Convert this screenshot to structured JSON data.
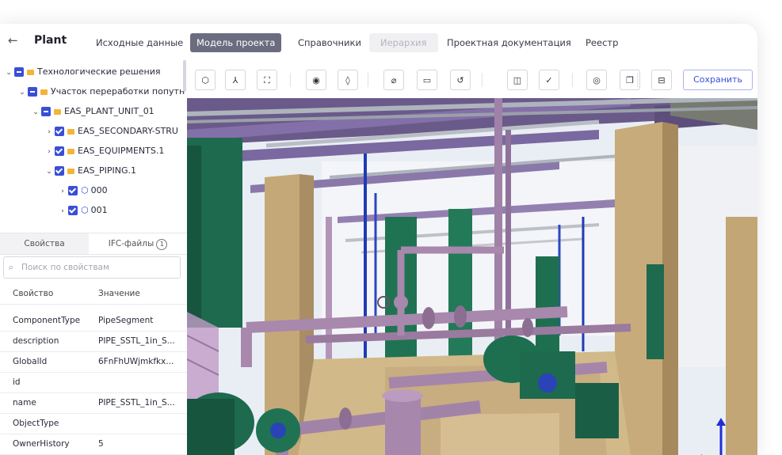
{
  "header": {
    "back_icon": "arrow-left-icon",
    "title": "Plant",
    "tabs": [
      {
        "label": "Исходные данные",
        "state": "normal"
      },
      {
        "label": "Модель проекта",
        "state": "active"
      },
      {
        "label": "Справочники",
        "state": "normal"
      },
      {
        "label": "Иерархия",
        "state": "disabled"
      },
      {
        "label": "Проектная документация",
        "state": "normal"
      },
      {
        "label": "Реестр",
        "state": "normal"
      }
    ]
  },
  "tree": {
    "items": [
      {
        "label": "Технологические решения",
        "level": 0,
        "check": "partial",
        "kind": "folder"
      },
      {
        "label": "Участок переработки попутн",
        "level": 1,
        "check": "partial",
        "kind": "folder"
      },
      {
        "label": "EAS_PLANT_UNIT_01",
        "level": 2,
        "check": "partial",
        "kind": "folder"
      },
      {
        "label": "EAS_SECONDARY-STRU",
        "level": 3,
        "check": "checked",
        "kind": "folder"
      },
      {
        "label": "EAS_EQUIPMENTS.1",
        "level": 3,
        "check": "checked",
        "kind": "folder"
      },
      {
        "label": "EAS_PIPING.1",
        "level": 3,
        "check": "checked",
        "kind": "folder"
      },
      {
        "label": "000",
        "level": 4,
        "check": "checked",
        "kind": "object"
      },
      {
        "label": "001",
        "level": 4,
        "check": "checked",
        "kind": "object"
      }
    ]
  },
  "panel": {
    "tabs": [
      {
        "label": "Свойства",
        "active": true
      },
      {
        "label": "IFC-файлы",
        "count": "1",
        "active": false
      }
    ],
    "search_placeholder": "Поиск по свойствам",
    "columns": {
      "key": "Свойство",
      "value": "Значение"
    },
    "rows": [
      {
        "key": "ComponentType",
        "value": "PipeSegment"
      },
      {
        "key": "description",
        "value": "PIPE_SSTL_1in_S..."
      },
      {
        "key": "GlobalId",
        "value": "6FnFhUWjmkfkx..."
      },
      {
        "key": "id",
        "value": ""
      },
      {
        "key": "name",
        "value": "PIPE_SSTL_1in_S..."
      },
      {
        "key": "ObjectType",
        "value": ""
      },
      {
        "key": "OwnerHistory",
        "value": "5"
      }
    ]
  },
  "toolbar": {
    "tools": [
      {
        "name": "view-cube-icon",
        "glyph": "⬡"
      },
      {
        "name": "axes-icon",
        "glyph": "⅄"
      },
      {
        "name": "fit-view-icon",
        "glyph": "⛶"
      },
      {
        "name": "visibility-icon",
        "glyph": "◉"
      },
      {
        "name": "transparency-icon",
        "glyph": "◊"
      },
      {
        "name": "measure-icon",
        "glyph": "⌀"
      },
      {
        "name": "comment-icon",
        "glyph": "▭"
      },
      {
        "name": "reset-icon",
        "glyph": "↺"
      },
      {
        "name": "split-view-icon",
        "glyph": "◫"
      },
      {
        "name": "check-icon",
        "glyph": "✓"
      },
      {
        "name": "screenshot-icon",
        "glyph": "◎"
      },
      {
        "name": "copy-icon",
        "glyph": "❐"
      },
      {
        "name": "section-icon",
        "glyph": "⊟"
      }
    ],
    "save_label": "Сохранить"
  },
  "colors": {
    "accent": "#3a4ed6",
    "active_tab": "#6b6c80",
    "pipe_purple": "#8a6a9a",
    "equipment_green": "#1d6a4e",
    "structure_tan": "#c5a878"
  },
  "viewport": {
    "scene": "3D plant piping model"
  }
}
